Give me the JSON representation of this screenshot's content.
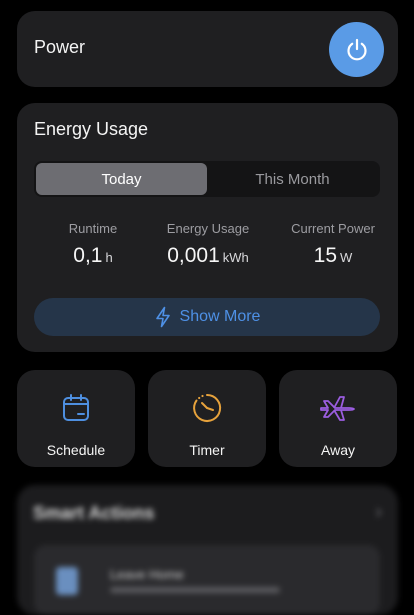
{
  "power": {
    "label": "Power",
    "button_icon": "power-icon",
    "button_color": "#5a9be6"
  },
  "energy": {
    "title": "Energy Usage",
    "tabs": [
      {
        "label": "Today",
        "active": true
      },
      {
        "label": "This Month",
        "active": false
      }
    ],
    "stats": [
      {
        "label": "Runtime",
        "value": "0,1",
        "unit": "h"
      },
      {
        "label": "Energy Usage",
        "value": "0,001",
        "unit": "kWh"
      },
      {
        "label": "Current Power",
        "value": "15",
        "unit": "W"
      }
    ],
    "show_more_label": "Show More",
    "show_more_icon": "lightning-icon"
  },
  "tiles": [
    {
      "label": "Schedule",
      "icon": "calendar-icon",
      "color": "#4e8fe0"
    },
    {
      "label": "Timer",
      "icon": "clock-icon",
      "color": "#e6a23c"
    },
    {
      "label": "Away",
      "icon": "airplane-icon",
      "color": "#9b5de0"
    }
  ],
  "smart_actions": {
    "title": "Smart Actions",
    "item_label": "Leave Home"
  }
}
